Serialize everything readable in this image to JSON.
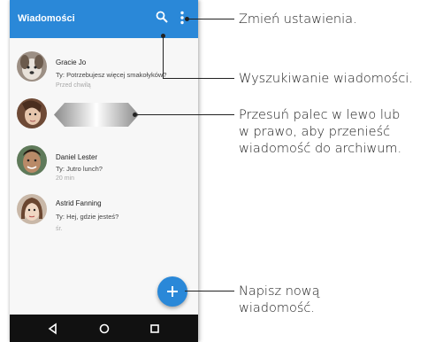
{
  "app": {
    "title": "Wiadomości"
  },
  "conversations": [
    {
      "name": "Gracie Jo",
      "preview": "Ty: Potrzebujesz więcej smakołyków?",
      "time": "Przed chwilą"
    },
    {
      "name": "Daniel Lester",
      "preview": "Ty: Jutro lunch?",
      "time": "20 min"
    },
    {
      "name": "Astrid Fanning",
      "preview": "Ty: Hej, gdzie jesteś?",
      "time": "śr."
    }
  ],
  "callouts": {
    "settings": "Zmień ustawienia.",
    "search": "Wyszukiwanie wiadomości.",
    "swipe_line1": "Przesuń palec w lewo lub",
    "swipe_line2": "w prawo, aby przenieść",
    "swipe_line3": "wiadomość do archiwum.",
    "compose_line1": "Napisz nową",
    "compose_line2": "wiadomość."
  },
  "icons": {
    "search": "search-icon",
    "more": "more-vert-icon",
    "compose": "plus-icon",
    "back": "back-icon",
    "home": "home-icon",
    "recents": "recents-icon"
  },
  "colors": {
    "accent": "#2a88d8",
    "navbar": "#111111"
  }
}
